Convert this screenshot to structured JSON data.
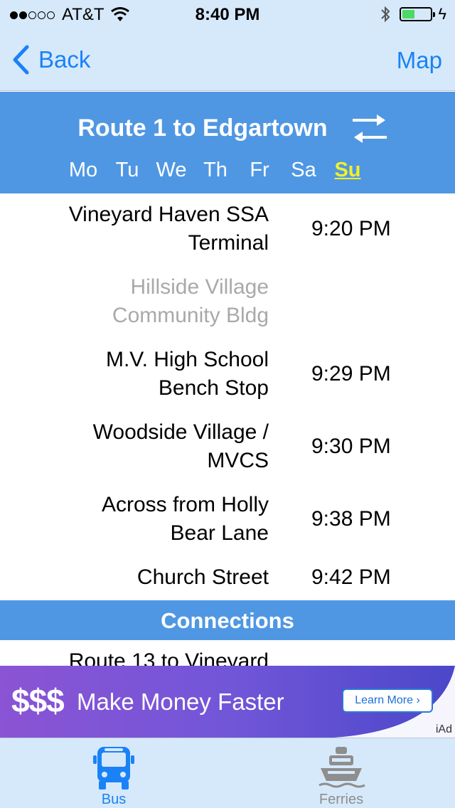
{
  "status_bar": {
    "carrier": "AT&T",
    "signal_bars": 2,
    "time": "8:40 PM",
    "battery_level": 0.45
  },
  "nav": {
    "back_label": "Back",
    "map_label": "Map"
  },
  "route": {
    "title": "Route 1 to Edgartown",
    "days": [
      "Mo",
      "Tu",
      "We",
      "Th",
      "Fr",
      "Sa",
      "Su"
    ],
    "selected_day": "Su"
  },
  "stops": [
    {
      "name_line1": "Vineyard Haven SSA",
      "name_line2": "Terminal",
      "time": "9:20 PM",
      "dimmed": false
    },
    {
      "name_line1": "Hillside Village",
      "name_line2": "Community Bldg",
      "time": "",
      "dimmed": true
    },
    {
      "name_line1": "M.V. High School",
      "name_line2": "Bench Stop",
      "time": "9:29 PM",
      "dimmed": false
    },
    {
      "name_line1": "Woodside Village /",
      "name_line2": "MVCS",
      "time": "9:30 PM",
      "dimmed": false
    },
    {
      "name_line1": "Across from Holly",
      "name_line2": "Bear Lane",
      "time": "9:38 PM",
      "dimmed": false
    },
    {
      "name_line1": "Church Street",
      "name_line2": "",
      "time": "9:42 PM",
      "dimmed": false
    }
  ],
  "connections": {
    "header": "Connections",
    "first_item": "Route 13 to Vineyard"
  },
  "ad": {
    "logo_text": "$$$",
    "headline": "Make Money Faster",
    "cta_label": "Learn More",
    "badge": "iAd"
  },
  "tabbar": {
    "bus_label": "Bus",
    "ferries_label": "Ferries"
  },
  "colors": {
    "accent": "#1a82f7",
    "header_blue": "#4f97e3",
    "bar_bg": "#d6e9fb",
    "active_day": "#f2f02a",
    "dimmed_text": "#a9a9a9",
    "battery": "#4cd964"
  }
}
